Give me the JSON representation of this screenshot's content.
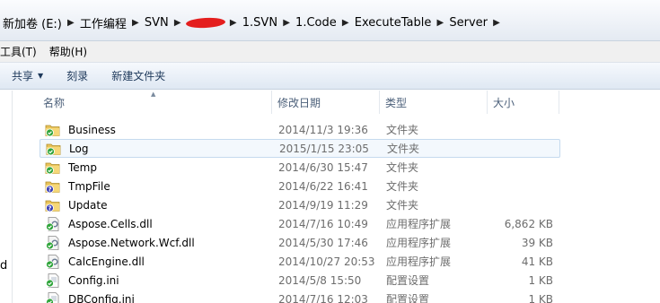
{
  "address": {
    "crumbs": [
      "新加卷 (E:)",
      "工作编程",
      "SVN",
      "1.SVN",
      "1.Code",
      "ExecuteTable",
      "Server"
    ],
    "separator": "▶"
  },
  "menu": {
    "items": [
      "工具(T)",
      "帮助(H)"
    ]
  },
  "toolbar": {
    "share": "共享",
    "burn": "刻录",
    "new_folder": "新建文件夹"
  },
  "nav": {
    "partial_label": "d"
  },
  "columns": {
    "name": "名称",
    "date": "修改日期",
    "type": "类型",
    "size": "大小"
  },
  "files": [
    {
      "name": "Business",
      "date": "2014/11/3 19:36",
      "type": "文件夹",
      "size": "",
      "icon": "folder-svn-ok-icon"
    },
    {
      "name": "Log",
      "date": "2015/1/15 23:05",
      "type": "文件夹",
      "size": "",
      "icon": "folder-svn-ok-icon"
    },
    {
      "name": "Temp",
      "date": "2014/6/30 15:47",
      "type": "文件夹",
      "size": "",
      "icon": "folder-svn-ok-icon"
    },
    {
      "name": "TmpFile",
      "date": "2014/6/22 16:41",
      "type": "文件夹",
      "size": "",
      "icon": "folder-svn-unversioned-icon"
    },
    {
      "name": "Update",
      "date": "2014/9/19 11:29",
      "type": "文件夹",
      "size": "",
      "icon": "folder-svn-unversioned-icon"
    },
    {
      "name": "Aspose.Cells.dll",
      "date": "2014/7/16 10:49",
      "type": "应用程序扩展",
      "size": "6,862 KB",
      "icon": "dll-svn-ok-icon"
    },
    {
      "name": "Aspose.Network.Wcf.dll",
      "date": "2014/5/30 17:46",
      "type": "应用程序扩展",
      "size": "39 KB",
      "icon": "dll-svn-ok-icon"
    },
    {
      "name": "CalcEngine.dll",
      "date": "2014/10/27 20:53",
      "type": "应用程序扩展",
      "size": "41 KB",
      "icon": "dll-svn-ok-icon"
    },
    {
      "name": "Config.ini",
      "date": "2014/5/8 15:50",
      "type": "配置设置",
      "size": "1 KB",
      "icon": "ini-svn-ok-icon"
    },
    {
      "name": "DBConfig.ini",
      "date": "2014/7/16 12:03",
      "type": "配置设置",
      "size": "1 KB",
      "icon": "ini-svn-ok-icon"
    }
  ],
  "selected_index": 1
}
